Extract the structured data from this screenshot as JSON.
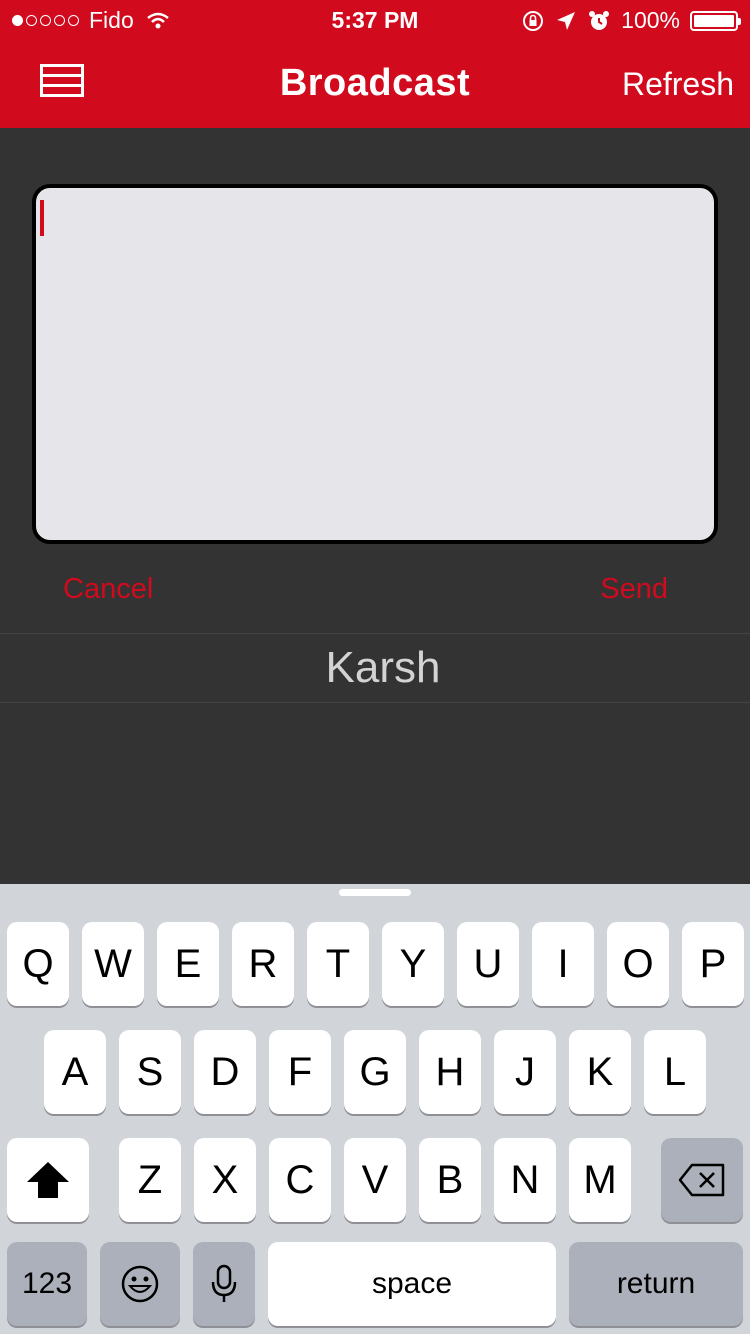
{
  "status_bar": {
    "carrier": "Fido",
    "time": "5:37 PM",
    "battery": "100%"
  },
  "nav": {
    "title": "Broadcast",
    "refresh_label": "Refresh"
  },
  "compose": {
    "message_value": "",
    "cancel_label": "Cancel",
    "send_label": "Send"
  },
  "recipient": {
    "name": "Karsh"
  },
  "keyboard": {
    "row1": [
      "Q",
      "W",
      "E",
      "R",
      "T",
      "Y",
      "U",
      "I",
      "O",
      "P"
    ],
    "row2": [
      "A",
      "S",
      "D",
      "F",
      "G",
      "H",
      "J",
      "K",
      "L"
    ],
    "row3": [
      "Z",
      "X",
      "C",
      "V",
      "B",
      "N",
      "M"
    ],
    "numbers_label": "123",
    "space_label": "space",
    "return_label": "return"
  },
  "colors": {
    "accent": "#d10a1d",
    "background": "#333333",
    "keyboard_bg": "#d1d4d9"
  }
}
